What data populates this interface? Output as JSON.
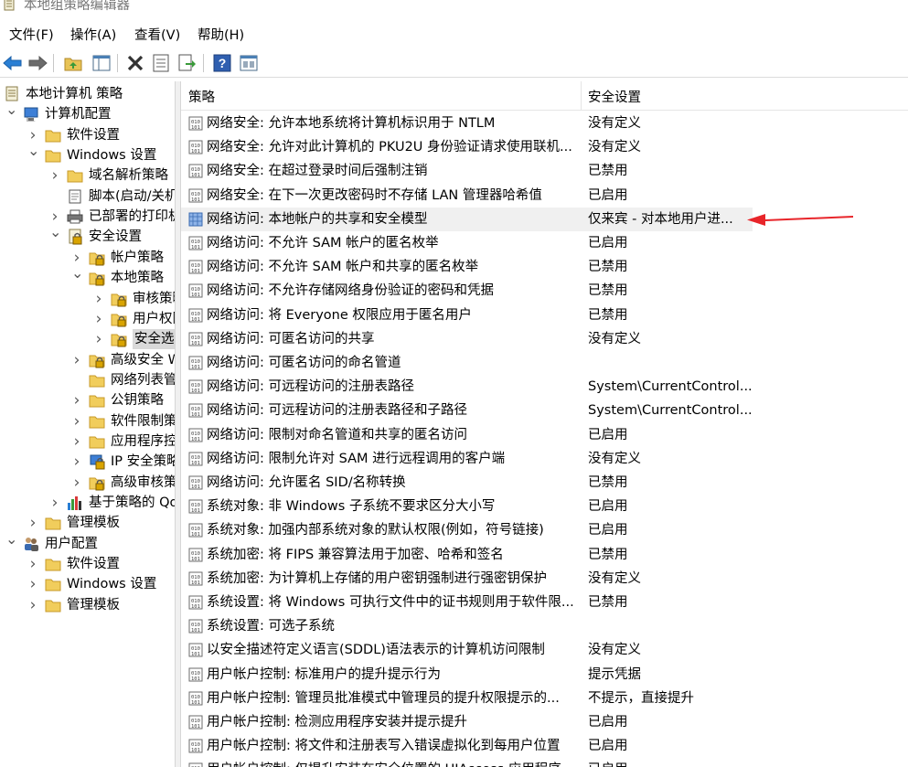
{
  "window": {
    "title": "本地组策略编辑器"
  },
  "menu": [
    "文件(F)",
    "操作(A)",
    "查看(V)",
    "帮助(H)"
  ],
  "toolbar": {
    "icons": [
      "back-arrow-icon",
      "forward-arrow-icon",
      "up-folder-icon",
      "show-hide-tree-icon",
      "delete-icon",
      "properties-icon",
      "export-list-icon",
      "help-icon",
      "console-view-icon"
    ]
  },
  "tree": [
    {
      "label": "本地计算机 策略",
      "depth": 0,
      "arrow": "",
      "icon": "policy-doc"
    },
    {
      "label": "计算机配置",
      "depth": 0,
      "arrow": "v",
      "icon": "computer"
    },
    {
      "label": "软件设置",
      "depth": 1,
      "arrow": ">",
      "icon": "folder"
    },
    {
      "label": "Windows 设置",
      "depth": 1,
      "arrow": "v",
      "icon": "folder"
    },
    {
      "label": "域名解析策略",
      "depth": 2,
      "arrow": ">",
      "icon": "folder"
    },
    {
      "label": "脚本(启动/关机)",
      "depth": 2,
      "arrow": "",
      "icon": "script"
    },
    {
      "label": "已部署的打印机",
      "depth": 2,
      "arrow": ">",
      "icon": "printer"
    },
    {
      "label": "安全设置",
      "depth": 2,
      "arrow": "v",
      "icon": "security"
    },
    {
      "label": "帐户策略",
      "depth": 3,
      "arrow": ">",
      "icon": "lock-folder"
    },
    {
      "label": "本地策略",
      "depth": 3,
      "arrow": "v",
      "icon": "lock-folder"
    },
    {
      "label": "审核策略",
      "depth": 4,
      "arrow": ">",
      "icon": "lock-folder"
    },
    {
      "label": "用户权限分配",
      "depth": 4,
      "arrow": ">",
      "icon": "lock-folder"
    },
    {
      "label": "安全选项",
      "depth": 4,
      "arrow": ">",
      "icon": "lock-folder",
      "selected": true
    },
    {
      "label": "高级安全 Windows Defender 防火墙",
      "depth": 3,
      "arrow": ">",
      "icon": "lock-folder"
    },
    {
      "label": "网络列表管理器策略",
      "depth": 3,
      "arrow": "",
      "icon": "folder"
    },
    {
      "label": "公钥策略",
      "depth": 3,
      "arrow": ">",
      "icon": "folder"
    },
    {
      "label": "软件限制策略",
      "depth": 3,
      "arrow": ">",
      "icon": "folder"
    },
    {
      "label": "应用程序控制策略",
      "depth": 3,
      "arrow": ">",
      "icon": "folder"
    },
    {
      "label": "IP 安全策略，在 本地计算机",
      "depth": 3,
      "arrow": ">",
      "icon": "ipsec"
    },
    {
      "label": "高级审核策略配置",
      "depth": 3,
      "arrow": ">",
      "icon": "lock-folder"
    },
    {
      "label": "基于策略的 QoS",
      "depth": 2,
      "arrow": ">",
      "icon": "chart"
    },
    {
      "label": "管理模板",
      "depth": 1,
      "arrow": ">",
      "icon": "folder"
    },
    {
      "label": "用户配置",
      "depth": 0,
      "arrow": "v",
      "icon": "users"
    },
    {
      "label": "软件设置",
      "depth": 1,
      "arrow": ">",
      "icon": "folder"
    },
    {
      "label": "Windows 设置",
      "depth": 1,
      "arrow": ">",
      "icon": "folder"
    },
    {
      "label": "管理模板",
      "depth": 1,
      "arrow": ">",
      "icon": "folder"
    }
  ],
  "list": {
    "columns": [
      "策略",
      "安全设置"
    ],
    "rows": [
      {
        "policy": "网络安全: 允许本地系统将计算机标识用于 NTLM",
        "setting": "没有定义"
      },
      {
        "policy": "网络安全: 允许对此计算机的 PKU2U 身份验证请求使用联机...",
        "setting": "没有定义"
      },
      {
        "policy": "网络安全: 在超过登录时间后强制注销",
        "setting": "已禁用"
      },
      {
        "policy": "网络安全: 在下一次更改密码时不存储 LAN 管理器哈希值",
        "setting": "已启用"
      },
      {
        "policy": "网络访问: 本地帐户的共享和安全模型",
        "setting": "仅来宾 - 对本地用户进...",
        "highlight": true,
        "icon": "policy-selected"
      },
      {
        "policy": "网络访问: 不允许 SAM 帐户的匿名枚举",
        "setting": "已启用"
      },
      {
        "policy": "网络访问: 不允许 SAM 帐户和共享的匿名枚举",
        "setting": "已禁用"
      },
      {
        "policy": "网络访问: 不允许存储网络身份验证的密码和凭据",
        "setting": "已禁用"
      },
      {
        "policy": "网络访问: 将 Everyone 权限应用于匿名用户",
        "setting": "已禁用"
      },
      {
        "policy": "网络访问: 可匿名访问的共享",
        "setting": "没有定义"
      },
      {
        "policy": "网络访问: 可匿名访问的命名管道",
        "setting": ""
      },
      {
        "policy": "网络访问: 可远程访问的注册表路径",
        "setting": "System\\CurrentControl..."
      },
      {
        "policy": "网络访问: 可远程访问的注册表路径和子路径",
        "setting": "System\\CurrentControl..."
      },
      {
        "policy": "网络访问: 限制对命名管道和共享的匿名访问",
        "setting": "已启用"
      },
      {
        "policy": "网络访问: 限制允许对 SAM 进行远程调用的客户端",
        "setting": "没有定义"
      },
      {
        "policy": "网络访问: 允许匿名 SID/名称转换",
        "setting": "已禁用"
      },
      {
        "policy": "系统对象: 非 Windows 子系统不要求区分大小写",
        "setting": "已启用"
      },
      {
        "policy": "系统对象: 加强内部系统对象的默认权限(例如，符号链接)",
        "setting": "已启用"
      },
      {
        "policy": "系统加密: 将 FIPS 兼容算法用于加密、哈希和签名",
        "setting": "已禁用"
      },
      {
        "policy": "系统加密: 为计算机上存储的用户密钥强制进行强密钥保护",
        "setting": "没有定义"
      },
      {
        "policy": "系统设置: 将 Windows 可执行文件中的证书规则用于软件限...",
        "setting": "已禁用"
      },
      {
        "policy": "系统设置: 可选子系统",
        "setting": ""
      },
      {
        "policy": "以安全描述符定义语言(SDDL)语法表示的计算机访问限制",
        "setting": "没有定义"
      },
      {
        "policy": "用户帐户控制: 标准用户的提升提示行为",
        "setting": "提示凭据"
      },
      {
        "policy": "用户帐户控制: 管理员批准模式中管理员的提升权限提示的...",
        "setting": "不提示，直接提升"
      },
      {
        "policy": "用户帐户控制: 检测应用程序安装并提示提升",
        "setting": "已启用"
      },
      {
        "policy": "用户帐户控制: 将文件和注册表写入错误虚拟化到每用户位置",
        "setting": "已启用"
      },
      {
        "policy": "用户帐户控制: 仅提升安装在安全位置的 UIAccess 应用程序",
        "setting": "已启用"
      }
    ]
  },
  "colors": {
    "arrow_red": "#e8252a",
    "highlight_row": "#f0f0f0",
    "selected_tree": "#d9d9d9"
  }
}
